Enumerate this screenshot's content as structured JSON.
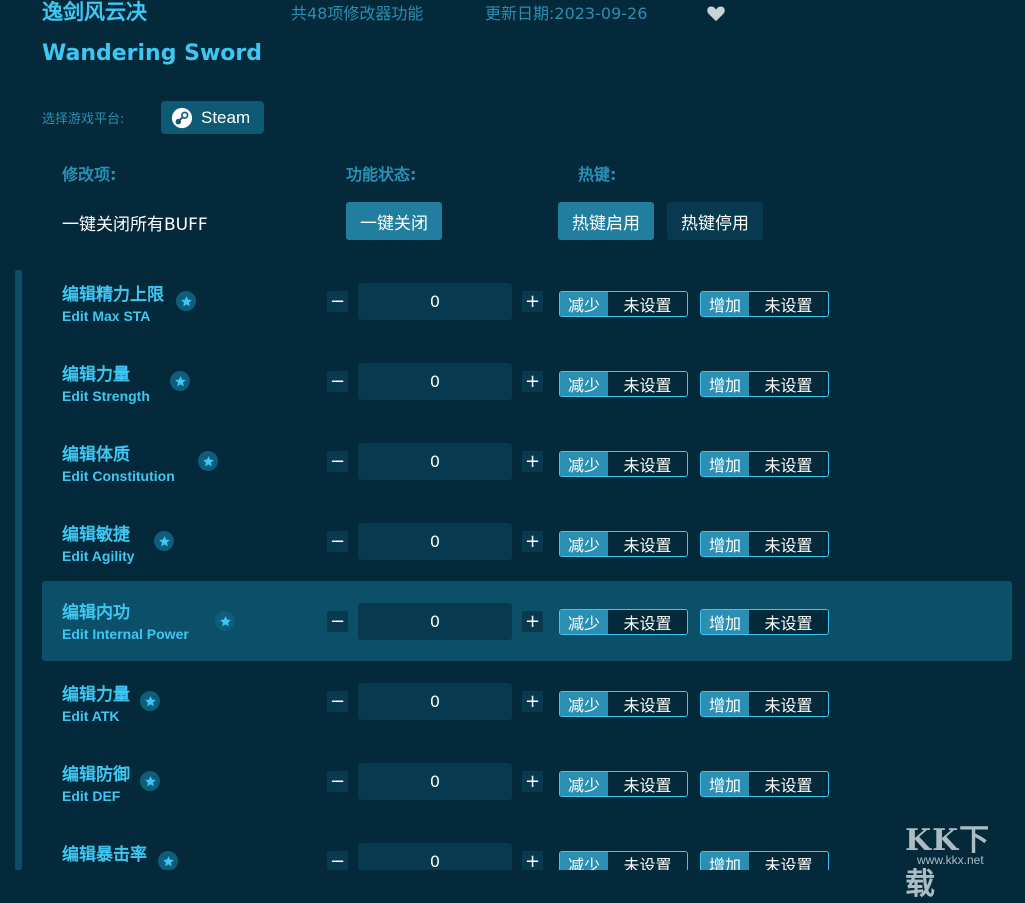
{
  "header": {
    "game_title_cn": "逸剑风云决",
    "game_title_en": "Wandering Sword",
    "feature_count": "共48项修改器功能",
    "update_date": "更新日期:2023-09-26"
  },
  "platform": {
    "label": "选择游戏平台:",
    "steam_label": "Steam"
  },
  "columns": {
    "mod": "修改项:",
    "status": "功能状态:",
    "hotkey": "热键:"
  },
  "global": {
    "buff_label": "一键关闭所有BUFF",
    "close_all": "一键关闭",
    "hotkey_on": "热键启用",
    "hotkey_off": "热键停用"
  },
  "controls": {
    "minus": "−",
    "plus": "+",
    "decrease": "减少",
    "increase": "增加",
    "unset": "未设置"
  },
  "rows": [
    {
      "cn": "编辑精力上限",
      "en": "Edit Max STA",
      "value": "0"
    },
    {
      "cn": "编辑力量",
      "en": "Edit Strength",
      "value": "0"
    },
    {
      "cn": "编辑体质",
      "en": "Edit Constitution",
      "value": "0"
    },
    {
      "cn": "编辑敏捷",
      "en": "Edit Agility",
      "value": "0"
    },
    {
      "cn": "编辑内功",
      "en": "Edit Internal Power",
      "value": "0"
    },
    {
      "cn": "编辑力量",
      "en": "Edit ATK",
      "value": "0"
    },
    {
      "cn": "编辑防御",
      "en": "Edit DEF",
      "value": "0"
    },
    {
      "cn": "编辑暴击率",
      "en": "",
      "value": "0"
    }
  ],
  "watermark": {
    "text": "KK下载",
    "url": "www.kkx.net"
  },
  "colors": {
    "background": "#04293a",
    "accent": "#3ec7f2",
    "muted": "#2a8fb3",
    "button": "#227e9e",
    "input": "#07394f",
    "highlight_row": "#0b4f69"
  }
}
